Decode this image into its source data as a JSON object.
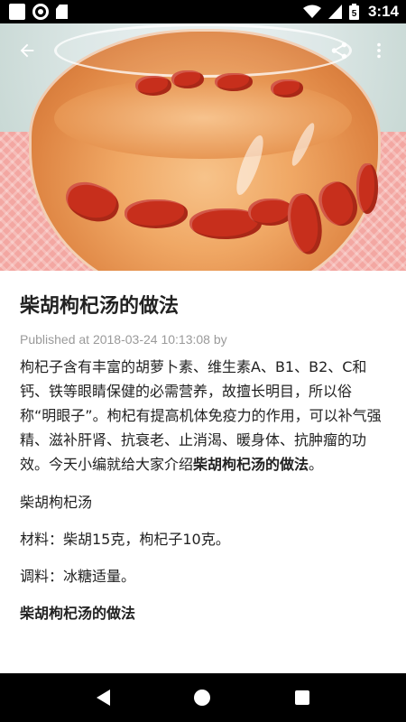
{
  "status_bar": {
    "time": "3:14",
    "battery_label": "5",
    "left_icons": [
      "notification-square-icon",
      "circle-app-icon",
      "sd-card-icon"
    ],
    "right_icons": [
      "wifi-icon",
      "signal-icon",
      "battery-icon"
    ]
  },
  "app_bar": {
    "back_icon": "arrow-left-icon",
    "share_icon": "share-icon",
    "menu_icon": "more-vert-icon",
    "icon_color": "#ffffff"
  },
  "article": {
    "title": "柴胡枸杞汤的做法",
    "meta": "Published at 2018-03-24 10:13:08 by",
    "intro_text": "枸杞子含有丰富的胡萝卜素、维生素A、B1、B2、C和钙、铁等眼睛保健的必需营养，故擅长明目，所以俗称“明眼子”。枸杞有提高机体免疫力的作用，可以补气强精、滋补肝肾、抗衰老、止消渴、暖身体、抗肿瘤的功效。今天小编就给大家介绍",
    "intro_bold": "柴胡枸杞汤的做法",
    "intro_end": "。",
    "line_dish": "柴胡枸杞汤",
    "line_ingredients": "材料：柴胡15克，枸杞子10克。",
    "line_seasoning": "调料：冰糖适量。",
    "line_method_heading": "柴胡枸杞汤的做法"
  },
  "nav_bar": {
    "icons": [
      "back-triangle-icon",
      "home-circle-icon",
      "recents-square-icon"
    ]
  },
  "colors": {
    "title_text": "#222222",
    "meta_text": "#9a9a9a",
    "status_bar_bg": "#000000",
    "nav_bar_bg": "#000000"
  }
}
